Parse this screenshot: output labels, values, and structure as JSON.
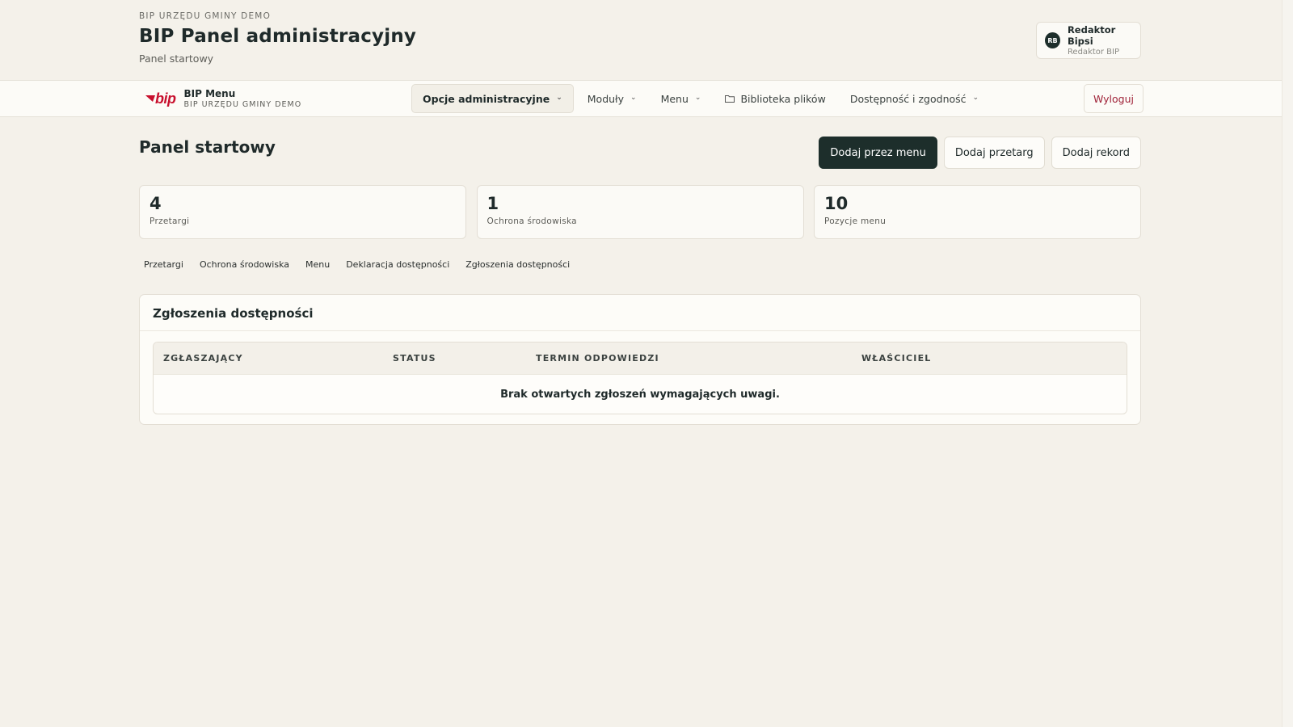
{
  "header": {
    "org_kicker": "BIP URZĘDU GMINY DEMO",
    "title": "BIP Panel administracyjny",
    "subtitle": "Panel startowy",
    "user": {
      "initials": "RB",
      "name": "Redaktor Bipsi",
      "role": "Redaktor BIP"
    }
  },
  "navbar": {
    "logo_text": "bip",
    "brand_name": "BIP Menu",
    "brand_sub": "BIP URZĘDU GMINY DEMO",
    "items": [
      {
        "label": "Opcje administracyjne",
        "icon": "chevron-down-icon"
      },
      {
        "label": "Moduły",
        "icon": "chevron-down-icon"
      },
      {
        "label": "Menu",
        "icon": "chevron-down-icon"
      },
      {
        "label": "Biblioteka plików",
        "icon": "folder-icon"
      },
      {
        "label": "Dostępność i zgodność",
        "icon": "chevron-down-icon"
      }
    ],
    "logout": "Wyloguj"
  },
  "main": {
    "heading": "Panel startowy",
    "actions": {
      "add_via_menu": "Dodaj przez menu",
      "add_tender": "Dodaj przetarg",
      "add_record": "Dodaj rekord"
    },
    "stats": [
      {
        "value": "4",
        "label": "Przetargi"
      },
      {
        "value": "1",
        "label": "Ochrona środowiska"
      },
      {
        "value": "10",
        "label": "Pozycje menu"
      }
    ],
    "quick_links": [
      "Przetargi",
      "Ochrona środowiska",
      "Menu",
      "Deklaracja dostępności",
      "Zgłoszenia dostępności"
    ],
    "panel": {
      "title": "Zgłoszenia dostępności",
      "columns": [
        "ZGŁASZAJĄCY",
        "STATUS",
        "TERMIN ODPOWIEDZI",
        "WŁAŚCICIEL"
      ],
      "empty_message": "Brak otwartych zgłoszeń wymagających uwagi."
    }
  },
  "colors": {
    "background": "#f4f1ea",
    "primary_button": "#1d2e2b",
    "logo_red": "#c8102e",
    "logout_text": "#a0243a"
  }
}
